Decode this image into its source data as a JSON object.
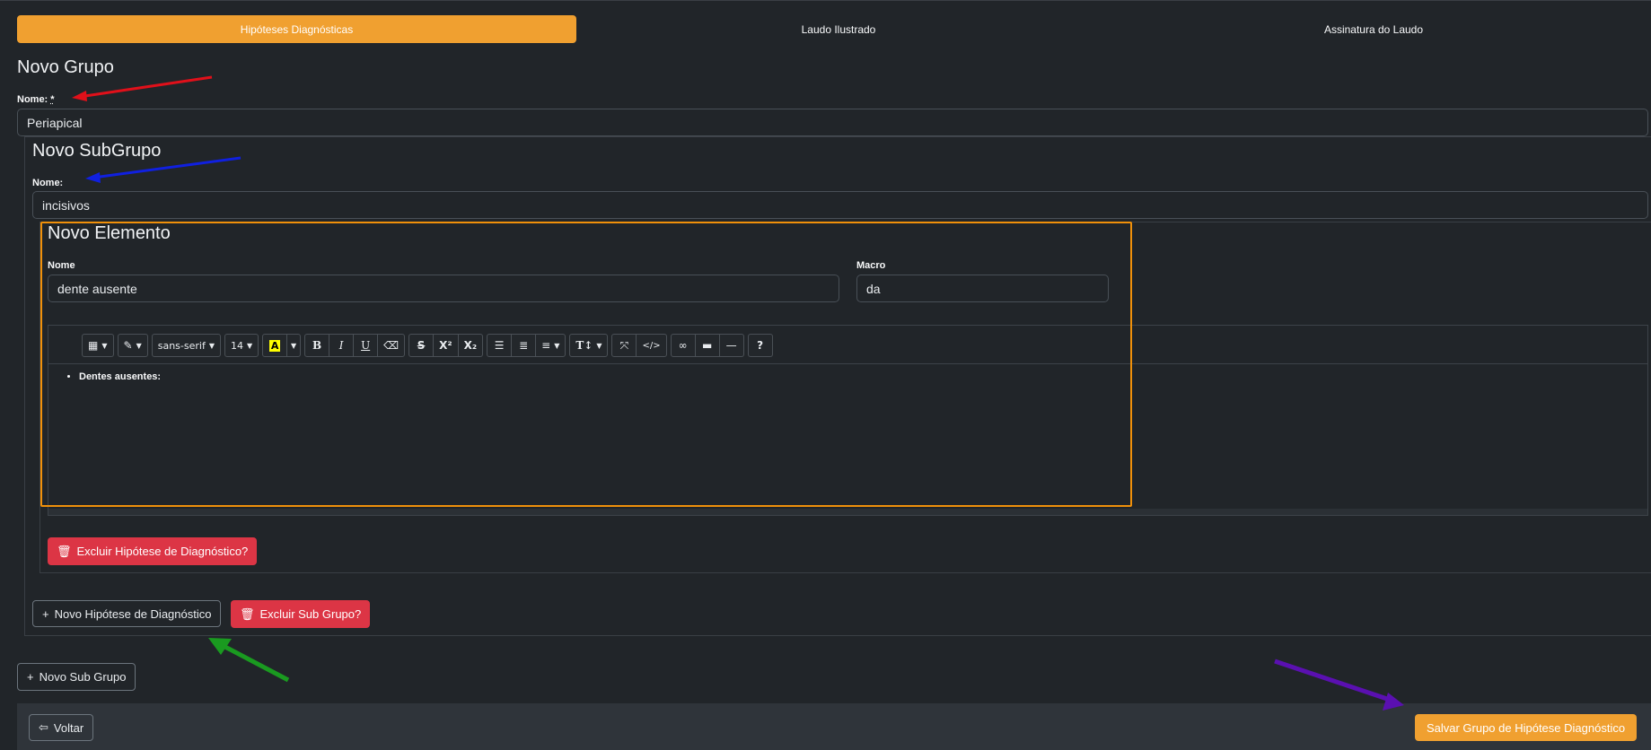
{
  "top": {
    "partial_text": "..."
  },
  "tabs": [
    {
      "label": "Hipóteses Diagnósticas",
      "active": true
    },
    {
      "label": "Laudo Ilustrado",
      "active": false
    },
    {
      "label": "Assinatura do Laudo",
      "active": false
    }
  ],
  "group": {
    "heading": "Novo Grupo",
    "name_label": "Nome:",
    "required_mark": "*",
    "name_value": "Periapical"
  },
  "subgroup": {
    "heading": "Novo SubGrupo",
    "name_label": "Nome:",
    "name_value": "incisivos"
  },
  "element": {
    "heading": "Novo Elemento",
    "name_label": "Nome",
    "name_value": "dente ausente",
    "macro_label": "Macro",
    "macro_value": "da"
  },
  "editor": {
    "font_name": "sans-serif",
    "font_size": "14",
    "content_items": [
      "Dentes ausentes:"
    ]
  },
  "buttons": {
    "delete_hypothesis": "Excluir Hipótese de Diagnóstico?",
    "new_hypothesis": "Novo Hipótese de Diagnóstico",
    "delete_subgroup": "Excluir Sub Grupo?",
    "new_subgroup": "Novo Sub Grupo",
    "back": "Voltar",
    "save": "Salvar Grupo de Hipótese Diagnóstico"
  },
  "colors": {
    "accent": "#f0a030",
    "danger": "#dc3545",
    "arrow_red": "#e0101a",
    "arrow_blue": "#1020e0",
    "arrow_green": "#1a9a20",
    "arrow_purple": "#5a10b0",
    "highlight_box": "#f0900a"
  }
}
